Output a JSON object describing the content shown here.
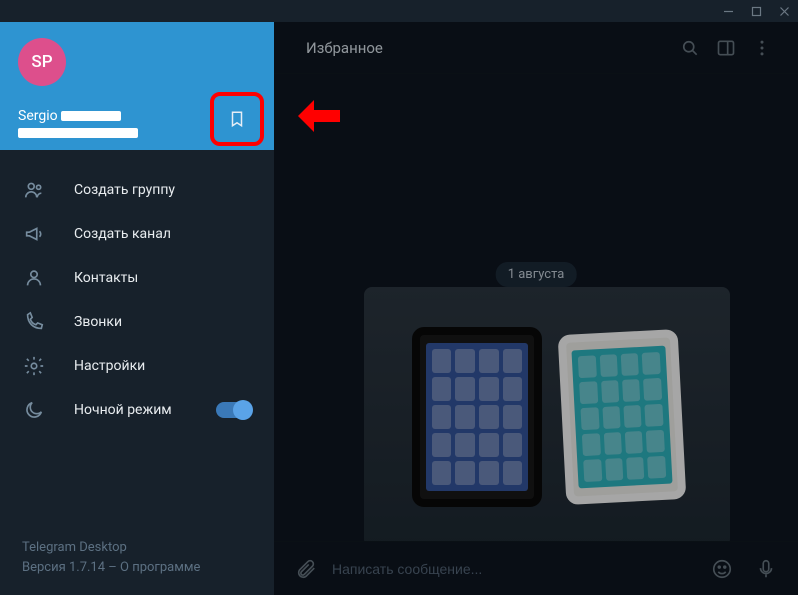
{
  "titlebar": {
    "icons": [
      "minimize",
      "maximize",
      "close"
    ]
  },
  "profile": {
    "initials": "SP",
    "name": "Sergio",
    "avatar_color": "#dd4f8c"
  },
  "menu": {
    "new_group": "Создать группу",
    "new_channel": "Создать канал",
    "contacts": "Контакты",
    "calls": "Звонки",
    "settings": "Настройки",
    "night_mode": "Ночной режим"
  },
  "footer": {
    "brand": "Telegram Desktop",
    "version_prefix": "Версия 1.7.14 – ",
    "about": "О программе"
  },
  "header": {
    "title": "Избранное"
  },
  "chat": {
    "date": "1 августа"
  },
  "composer": {
    "placeholder": "Написать сообщение..."
  }
}
